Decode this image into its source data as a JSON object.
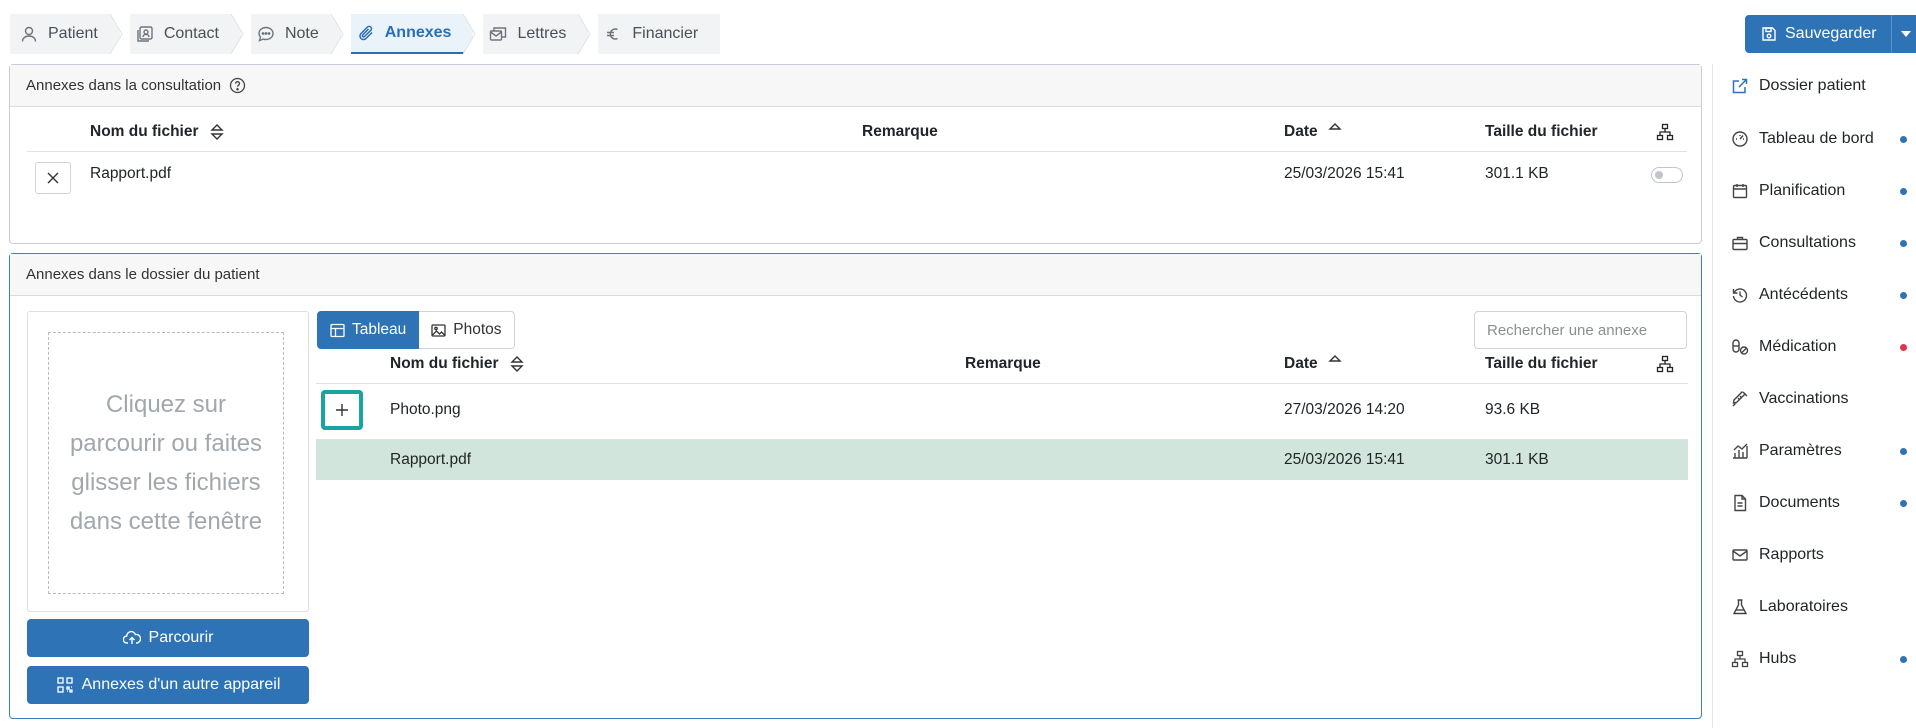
{
  "tabs": [
    {
      "label": "Patient",
      "icon": "user-icon"
    },
    {
      "label": "Contact",
      "icon": "contact-card-icon"
    },
    {
      "label": "Note",
      "icon": "chat-bubble-icon"
    },
    {
      "label": "Annexes",
      "icon": "paperclip-icon",
      "active": true
    },
    {
      "label": "Lettres",
      "icon": "letters-icon"
    },
    {
      "label": "Financier",
      "icon": "euro-icon"
    }
  ],
  "toolbar": {
    "save_label": "Sauvegarder"
  },
  "consultation": {
    "title": "Annexes dans la consultation",
    "columns": {
      "name": "Nom du fichier",
      "remark": "Remarque",
      "date": "Date",
      "size": "Taille du fichier"
    },
    "rows": [
      {
        "name": "Rapport.pdf",
        "remark": "",
        "date": "25/03/2026 15:41",
        "size": "301.1 KB",
        "toggle": false
      }
    ]
  },
  "dossier": {
    "title": "Annexes dans le dossier du patient",
    "dropzone_text": "Cliquez sur parcourir ou faites glisser les fichiers dans cette fenêtre",
    "browse_label": "Parcourir",
    "other_device_label": "Annexes d'un autre appareil",
    "view_tabs": [
      {
        "label": "Tableau",
        "active": true
      },
      {
        "label": "Photos",
        "active": false
      }
    ],
    "search_placeholder": "Rechercher une annexe",
    "columns": {
      "name": "Nom du fichier",
      "remark": "Remarque",
      "date": "Date",
      "size": "Taille du fichier"
    },
    "rows": [
      {
        "name": "Photo.png",
        "remark": "",
        "date": "27/03/2026 14:20",
        "size": "93.6 KB",
        "selected": false
      },
      {
        "name": "Rapport.pdf",
        "remark": "",
        "date": "25/03/2026 15:41",
        "size": "301.1 KB",
        "selected": true
      }
    ]
  },
  "sidebar": {
    "items": [
      {
        "label": "Dossier patient",
        "icon": "external-link-icon",
        "dot": null
      },
      {
        "label": "Tableau de bord",
        "icon": "dashboard-icon",
        "dot": "#2f73b7"
      },
      {
        "label": "Planification",
        "icon": "calendar-icon",
        "dot": "#2f73b7"
      },
      {
        "label": "Consultations",
        "icon": "briefcase-icon",
        "dot": "#2f73b7"
      },
      {
        "label": "Antécédents",
        "icon": "history-icon",
        "dot": "#2f73b7"
      },
      {
        "label": "Médication",
        "icon": "pills-icon",
        "dot": "#e0344b"
      },
      {
        "label": "Vaccinations",
        "icon": "syringe-icon",
        "dot": null
      },
      {
        "label": "Paramètres",
        "icon": "chart-icon",
        "dot": "#2f73b7"
      },
      {
        "label": "Documents",
        "icon": "document-icon",
        "dot": "#2f73b7"
      },
      {
        "label": "Rapports",
        "icon": "envelope-icon",
        "dot": null
      },
      {
        "label": "Laboratoires",
        "icon": "flask-icon",
        "dot": null
      },
      {
        "label": "Hubs",
        "icon": "hubs-icon",
        "dot": "#2f73b7"
      }
    ]
  },
  "colors": {
    "primary": "#2f73b7",
    "selected_row": "#d2e5dc",
    "highlight": "#1aa3a3",
    "alert_dot": "#e0344b"
  }
}
